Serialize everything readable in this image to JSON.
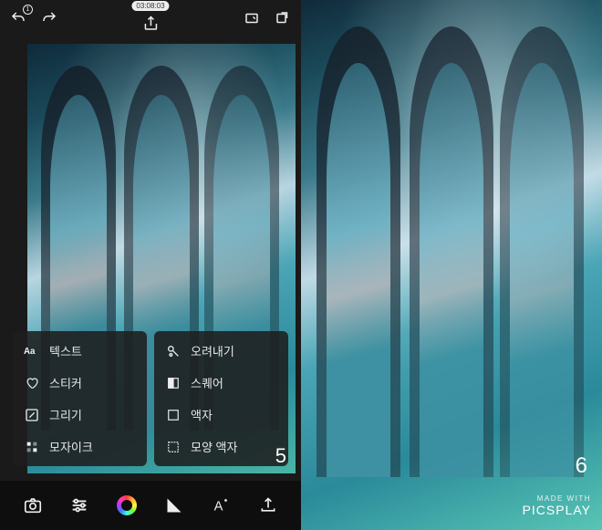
{
  "top": {
    "undo_count": "1",
    "timer": "03:08:03"
  },
  "menu": {
    "left": [
      {
        "icon": "text-aa-icon",
        "label": "텍스트"
      },
      {
        "icon": "heart-icon",
        "label": "스티커"
      },
      {
        "icon": "pencil-icon",
        "label": "그리기"
      },
      {
        "icon": "mosaic-icon",
        "label": "모자이크"
      }
    ],
    "right": [
      {
        "icon": "crop-icon",
        "label": "오려내기"
      },
      {
        "icon": "square-half-icon",
        "label": "스퀘어"
      },
      {
        "icon": "frame-icon",
        "label": "액자"
      },
      {
        "icon": "shape-frame-icon",
        "label": "모양 액자"
      }
    ]
  },
  "slide_left": "5",
  "slide_right": "6",
  "watermark": {
    "line1": "MADE WITH",
    "line2": "PICSPLAY"
  }
}
